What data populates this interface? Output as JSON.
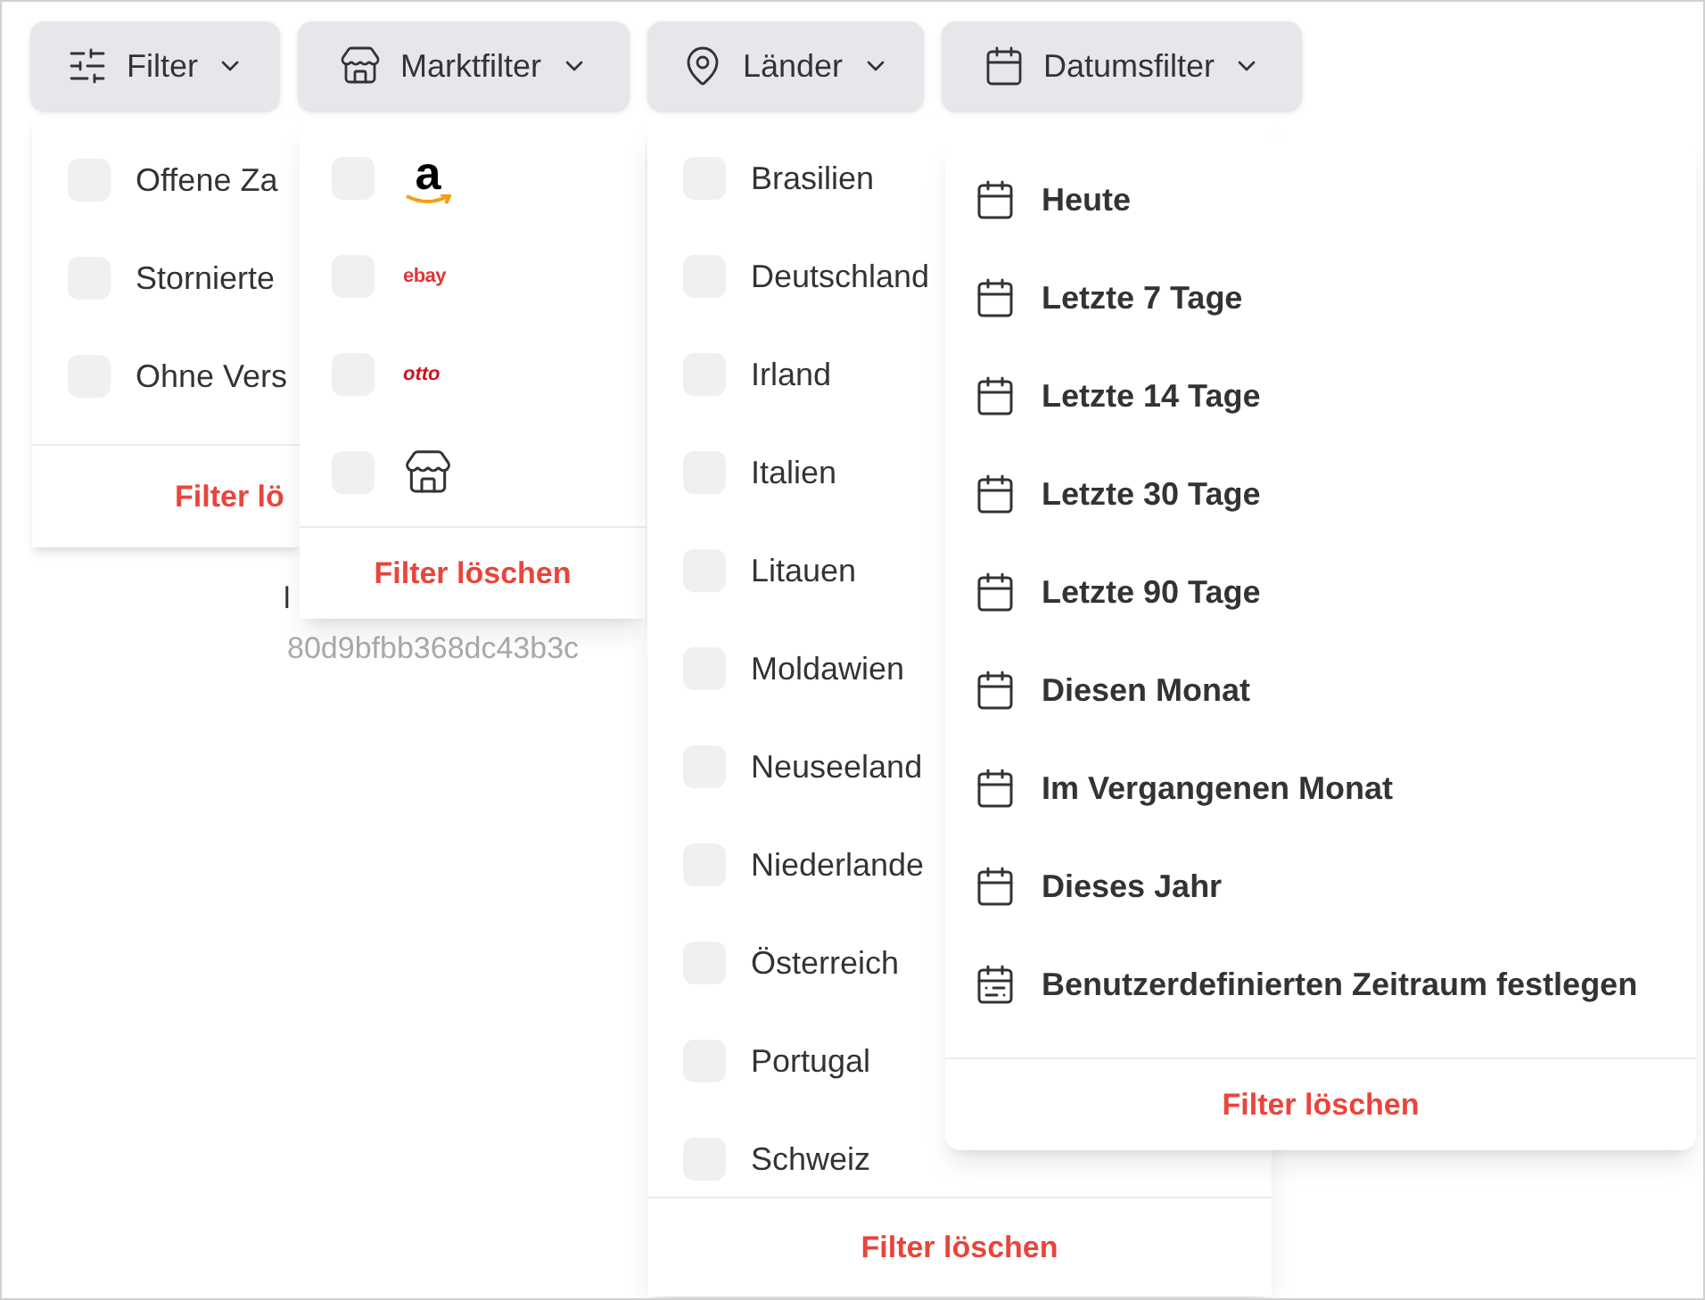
{
  "toolbar": [
    {
      "kind": "filter",
      "label": "Filter"
    },
    {
      "kind": "market",
      "label": "Marktfilter"
    },
    {
      "kind": "country",
      "label": "Länder"
    },
    {
      "kind": "date",
      "label": "Datumsfilter"
    }
  ],
  "background_text": {
    "label": "l",
    "hash": "80d9bfbb368dc43b3c"
  },
  "filter_menu": {
    "items": [
      {
        "label": "Offene Za",
        "checked": false
      },
      {
        "label": "Stornierte",
        "checked": false
      },
      {
        "label": "Ohne Vers",
        "checked": false
      }
    ],
    "clear": "Filter lö"
  },
  "market_menu": {
    "items": [
      {
        "kind": "amazon",
        "logo": "a",
        "checked": false
      },
      {
        "kind": "ebay",
        "logo": "ebay",
        "checked": false
      },
      {
        "kind": "otto",
        "logo": "otto",
        "checked": false
      },
      {
        "kind": "store",
        "checked": false
      }
    ],
    "clear": "Filter löschen"
  },
  "country_menu": {
    "items": [
      {
        "label": "Brasilien",
        "checked": false
      },
      {
        "label": "Deutschland",
        "checked": false
      },
      {
        "label": "Irland",
        "checked": false
      },
      {
        "label": "Italien",
        "checked": false
      },
      {
        "label": "Litauen",
        "checked": false
      },
      {
        "label": "Moldawien",
        "checked": false
      },
      {
        "label": "Neuseeland",
        "checked": false
      },
      {
        "label": "Niederlande",
        "checked": false
      },
      {
        "label": "Österreich",
        "checked": false
      },
      {
        "label": "Portugal",
        "checked": false
      },
      {
        "label": "Schweiz",
        "checked": false
      }
    ],
    "clear": "Filter löschen"
  },
  "date_menu": {
    "items": [
      {
        "kind": "preset",
        "label": "Heute"
      },
      {
        "kind": "preset",
        "label": "Letzte 7 Tage"
      },
      {
        "kind": "preset",
        "label": "Letzte 14 Tage"
      },
      {
        "kind": "preset",
        "label": "Letzte 30 Tage"
      },
      {
        "kind": "preset",
        "label": "Letzte 90 Tage"
      },
      {
        "kind": "preset",
        "label": "Diesen Monat"
      },
      {
        "kind": "preset",
        "label": "Im Vergangenen Monat"
      },
      {
        "kind": "preset",
        "label": "Dieses Jahr"
      },
      {
        "kind": "custom",
        "label": "Benutzerdefinierten Zeitraum festlegen"
      }
    ],
    "clear": "Filter löschen"
  }
}
